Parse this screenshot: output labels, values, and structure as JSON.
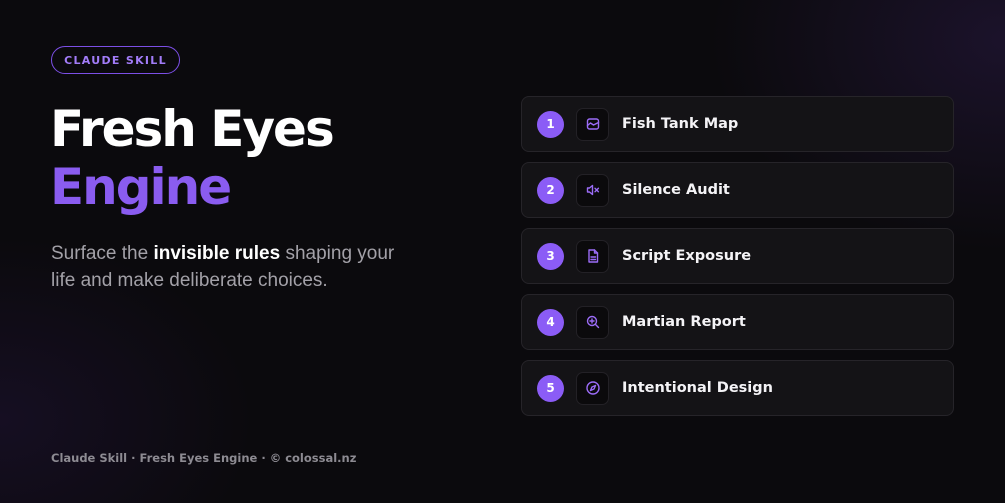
{
  "badge": {
    "label": "CLAUDE SKILL"
  },
  "title": {
    "line1": "Fresh Eyes",
    "line2": "Engine"
  },
  "subtitle": {
    "before": "Surface the ",
    "emphasis": "invisible rules",
    "after": " shaping your life and make deliberate choices."
  },
  "steps": [
    {
      "number": "1",
      "label": "Fish Tank Map",
      "icon": "image-frame-icon"
    },
    {
      "number": "2",
      "label": "Silence Audit",
      "icon": "speaker-mute-icon"
    },
    {
      "number": "3",
      "label": "Script Exposure",
      "icon": "document-icon"
    },
    {
      "number": "4",
      "label": "Martian Report",
      "icon": "zoom-search-icon"
    },
    {
      "number": "5",
      "label": "Intentional Design",
      "icon": "compass-icon"
    }
  ],
  "footer": {
    "text": "Claude Skill · Fresh Eyes Engine · © colossal.nz"
  },
  "colors": {
    "accent": "#8b5cf6",
    "accent_text": "#8a5cf0",
    "background": "#0b0a0d",
    "card": "#141316",
    "muted_text": "#a3a1a8"
  }
}
